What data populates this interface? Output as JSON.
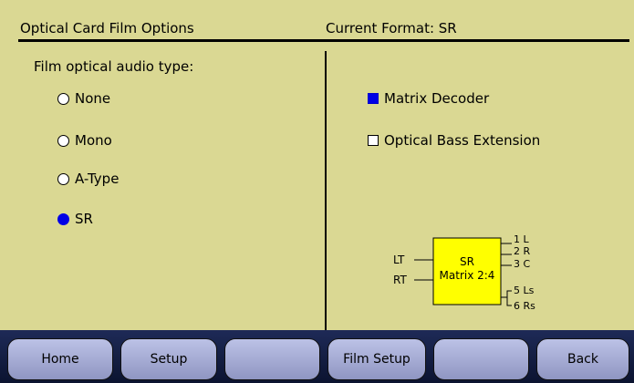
{
  "header": {
    "title": "Optical Card Film Options",
    "format": "Current Format: SR"
  },
  "audio": {
    "label": "Film optical audio type:",
    "options": [
      {
        "label": "None",
        "selected": false
      },
      {
        "label": "Mono",
        "selected": false
      },
      {
        "label": "A-Type",
        "selected": false
      },
      {
        "label": "SR",
        "selected": true
      }
    ]
  },
  "checks": [
    {
      "label": "Matrix Decoder",
      "checked": true
    },
    {
      "label": "Optical Bass Extension",
      "checked": false
    }
  ],
  "diagram": {
    "box_line1": "SR",
    "box_line2": "Matrix 2:4",
    "inputs": [
      "LT",
      "RT"
    ],
    "outputs": [
      "1 L",
      "2 R",
      "3 C",
      "5 Ls",
      "6 Rs"
    ],
    "box_color": "#ffff00"
  },
  "toolbar": {
    "buttons": [
      "Home",
      "Setup",
      "",
      "Film Setup",
      "",
      "Back"
    ]
  },
  "colors": {
    "background": "#dad893",
    "selected": "#0000e6",
    "toolbar_bg": "#101a40"
  }
}
